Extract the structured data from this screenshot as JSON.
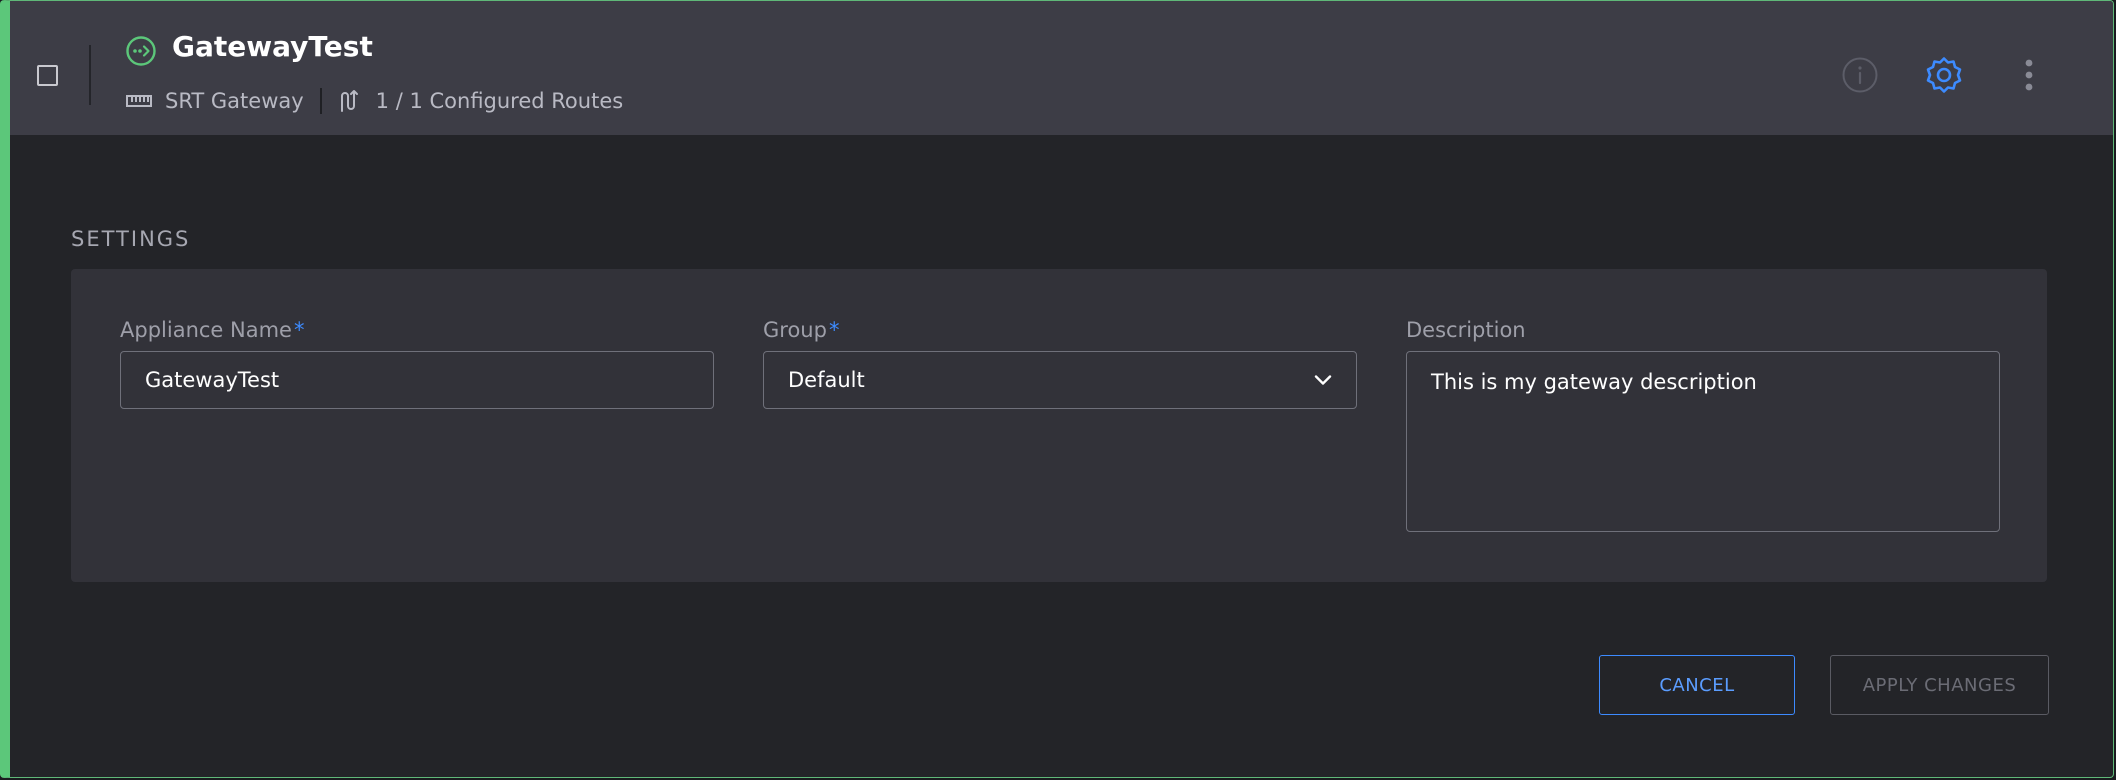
{
  "header": {
    "title": "GatewayTest",
    "type_label": "SRT Gateway",
    "routes_label": "1 / 1 Configured Routes",
    "status_color": "#5cc77a"
  },
  "icons": {
    "status": "gateway-status-icon",
    "type": "ethernet-port-icon",
    "routes": "routes-icon",
    "info": "info-icon",
    "settings": "gear-icon",
    "more": "more-vertical-icon"
  },
  "settings": {
    "section_title": "SETTINGS",
    "appliance_name": {
      "label": "Appliance Name",
      "required_mark": "*",
      "value": "GatewayTest"
    },
    "group": {
      "label": "Group",
      "required_mark": "*",
      "value": "Default"
    },
    "description": {
      "label": "Description",
      "value": "This is my gateway description"
    }
  },
  "actions": {
    "cancel_label": "CANCEL",
    "apply_label": "APPLY CHANGES"
  },
  "colors": {
    "accent": "#3d8bff",
    "active_border": "#5cc77a"
  }
}
